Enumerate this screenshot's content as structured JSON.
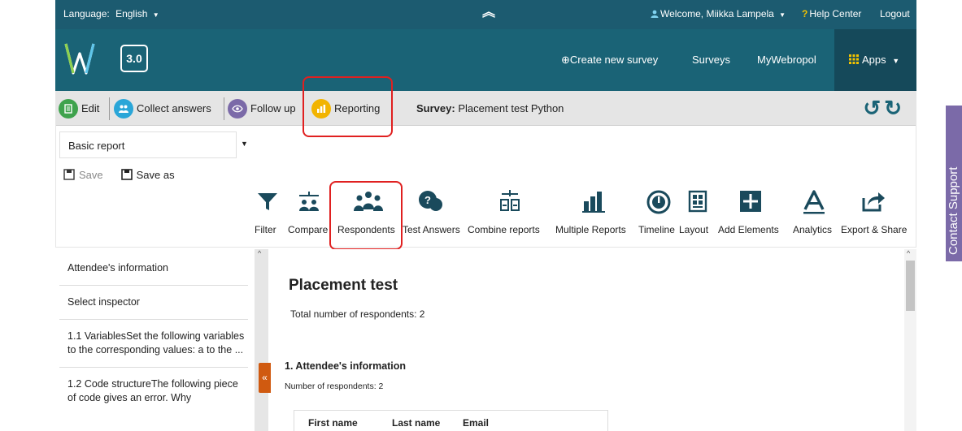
{
  "topbar": {
    "language_label": "Language:",
    "language_value": "English",
    "welcome": "Welcome, Miikka Lampela",
    "help": "Help Center",
    "logout": "Logout"
  },
  "header": {
    "version": "3.0",
    "create_survey": "Create new survey",
    "surveys": "Surveys",
    "mywebropol": "MyWebropol",
    "apps": "Apps"
  },
  "subnav": {
    "edit": "Edit",
    "collect": "Collect answers",
    "followup": "Follow up",
    "reporting": "Reporting",
    "survey_label": "Survey:",
    "survey_name": "Placement test Python"
  },
  "report_select": {
    "value": "Basic report"
  },
  "save": {
    "save": "Save",
    "save_as": "Save as"
  },
  "tools": [
    {
      "label": "Filter",
      "icon": "filter-icon"
    },
    {
      "label": "Compare",
      "icon": "compare-icon"
    },
    {
      "label": "Respondents",
      "icon": "respondents-icon"
    },
    {
      "label": "Test Answers",
      "icon": "test-answers-icon"
    },
    {
      "label": "Combine reports",
      "icon": "combine-reports-icon"
    },
    {
      "label": "Multiple Reports",
      "icon": "multiple-reports-icon"
    },
    {
      "label": "Timeline",
      "icon": "timeline-icon"
    },
    {
      "label": "Layout",
      "icon": "layout-icon"
    },
    {
      "label": "Add Elements",
      "icon": "add-elements-icon"
    },
    {
      "label": "Analytics",
      "icon": "analytics-icon"
    },
    {
      "label": "Export & Share",
      "icon": "export-share-icon"
    }
  ],
  "left_nav": [
    "Attendee's information",
    "Select inspector",
    "1.1 VariablesSet the following variables to the corresponding values:  a to the ...",
    "1.2 Code structureThe following piece of code gives an error. Why"
  ],
  "report": {
    "title": "Placement test",
    "total": "Total number of respondents: 2",
    "question_title": "1. Attendee's information",
    "question_count": "Number of respondents: 2",
    "columns": [
      "First name",
      "Last name",
      "Email"
    ]
  },
  "contact_support": "Contact Support",
  "colors": {
    "topbar": "#1c5b70",
    "header": "#1a6376",
    "highlight": "#e02020",
    "contact": "#7b6aa8"
  }
}
